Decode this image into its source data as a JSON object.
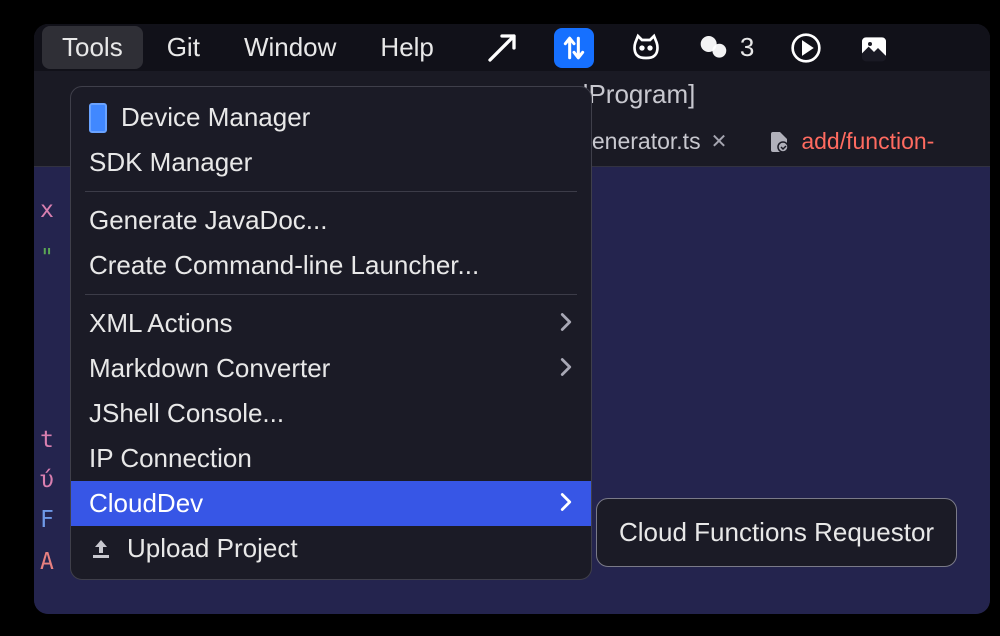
{
  "menubar": {
    "items": [
      "Tools",
      "Git",
      "Window",
      "Help"
    ],
    "active_index": 0,
    "status_count": "3"
  },
  "breadcrumb": {
    "visible_text": "dProgram]"
  },
  "tabs": [
    {
      "label": "Generator.ts",
      "closable": true,
      "style": "normal"
    },
    {
      "label": "add/function-",
      "closable": false,
      "style": "red"
    }
  ],
  "gutter": {
    "t1": "x",
    "t2": "\"",
    "t3": "t",
    "t4": "ύ",
    "t5": "F",
    "t6": "A"
  },
  "dropdown": {
    "items": [
      {
        "label": "Device Manager",
        "icon": "device",
        "submenu": false
      },
      {
        "label": "SDK Manager",
        "icon": null,
        "submenu": false
      },
      "separator",
      {
        "label": "Generate JavaDoc...",
        "icon": null,
        "submenu": false
      },
      {
        "label": "Create Command-line Launcher...",
        "icon": null,
        "submenu": false
      },
      "separator",
      {
        "label": "XML Actions",
        "icon": null,
        "submenu": true
      },
      {
        "label": "Markdown Converter",
        "icon": null,
        "submenu": true
      },
      {
        "label": "JShell Console...",
        "icon": null,
        "submenu": false
      },
      {
        "label": "IP Connection",
        "icon": null,
        "submenu": false
      },
      {
        "label": "CloudDev",
        "icon": null,
        "submenu": true,
        "highlighted": true
      },
      {
        "label": "Upload Project",
        "icon": "upload",
        "submenu": false
      }
    ]
  },
  "submenu": {
    "items": [
      {
        "label": "Cloud Functions Requestor"
      }
    ]
  }
}
